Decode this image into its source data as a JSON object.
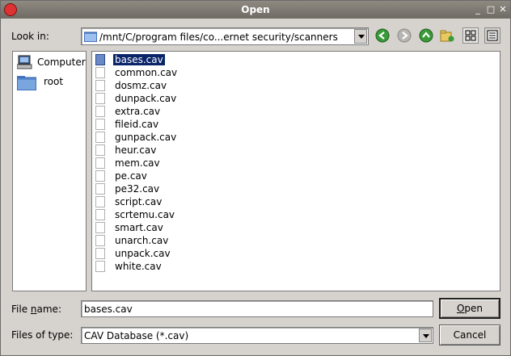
{
  "window": {
    "title": "Open"
  },
  "lookin": {
    "label": "Look in:",
    "path": "/mnt/C/program files/co...ernet security/scanners"
  },
  "sidebar": {
    "items": [
      {
        "label": "Computer",
        "icon": "computer-icon"
      },
      {
        "label": "root",
        "icon": "folder-icon"
      }
    ]
  },
  "files": [
    "bases.cav",
    "common.cav",
    "dosmz.cav",
    "dunpack.cav",
    "extra.cav",
    "fileid.cav",
    "gunpack.cav",
    "heur.cav",
    "mem.cav",
    "pe.cav",
    "pe32.cav",
    "script.cav",
    "scrtemu.cav",
    "smart.cav",
    "unarch.cav",
    "unpack.cav",
    "white.cav"
  ],
  "selected_file": "bases.cav",
  "filename": {
    "label_pre": "File ",
    "label_u": "n",
    "label_post": "ame:",
    "value": "bases.cav"
  },
  "filetype": {
    "label": "Files of type:",
    "value": "CAV Database (*.cav)"
  },
  "buttons": {
    "open_u": "O",
    "open_rest": "pen",
    "cancel": "Cancel"
  },
  "colors": {
    "selection": "#0a246a",
    "back": "#2e8b2e",
    "up": "#2e8b2e"
  }
}
